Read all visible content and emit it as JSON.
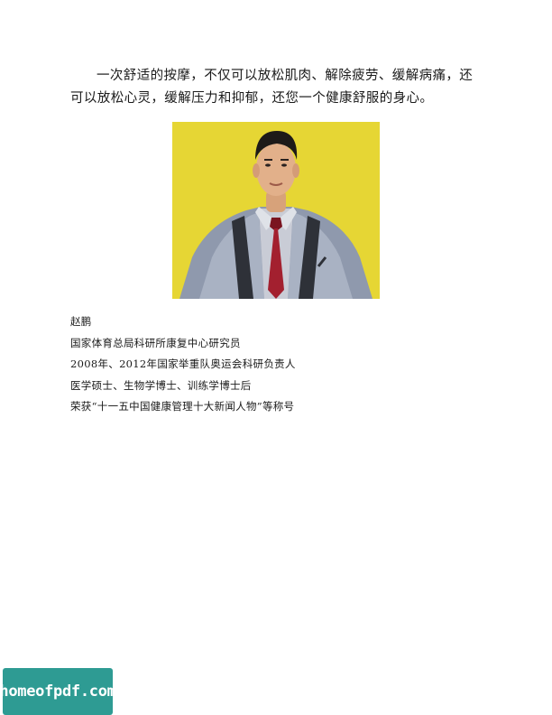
{
  "intro": {
    "line1": "一次舒适的按摩，不仅可以放松肌肉、解除疲劳、缓解病痛，还",
    "line2": "可以放松心灵，缓解压力和抑郁，还您一个健康舒服的身心。"
  },
  "photo": {
    "background_color": "#e6d634"
  },
  "bio": {
    "name": "赵鹏",
    "lines": [
      "国家体育总局科研所康复中心研究员",
      "2008年、2012年国家举重队奥运会科研负责人",
      "医学硕士、生物学博士、训练学博士后",
      "荣获“十一五中国健康管理十大新闻人物”等称号"
    ]
  },
  "watermark": {
    "text": "homeofpdf.com",
    "color": "#2e9b93"
  }
}
